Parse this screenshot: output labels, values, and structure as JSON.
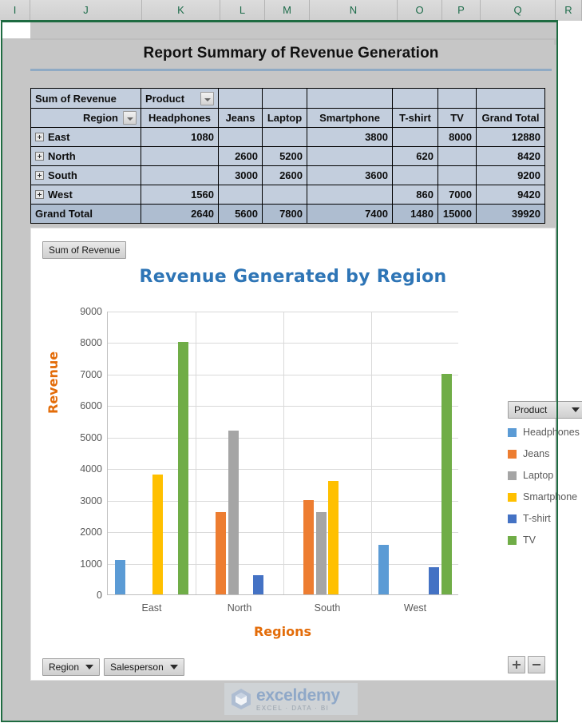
{
  "spreadsheet": {
    "column_headers": [
      "I",
      "J",
      "K",
      "L",
      "M",
      "N",
      "O",
      "P",
      "Q",
      "R"
    ]
  },
  "report": {
    "title": "Report Summary of Revenue Generation"
  },
  "pivot_table": {
    "value_field_label": "Sum of Revenue",
    "column_field_label": "Product",
    "row_field_label": "Region",
    "column_headers": [
      "Headphones",
      "Jeans",
      "Laptop",
      "Smartphone",
      "T-shirt",
      "TV",
      "Grand Total"
    ],
    "rows": [
      {
        "region": "East",
        "Headphones": "1080",
        "Jeans": "",
        "Laptop": "",
        "Smartphone": "3800",
        "T-shirt": "",
        "TV": "8000",
        "Grand Total": "12880"
      },
      {
        "region": "North",
        "Headphones": "",
        "Jeans": "2600",
        "Laptop": "5200",
        "Smartphone": "",
        "T-shirt": "620",
        "TV": "",
        "Grand Total": "8420"
      },
      {
        "region": "South",
        "Headphones": "",
        "Jeans": "3000",
        "Laptop": "2600",
        "Smartphone": "3600",
        "T-shirt": "",
        "TV": "",
        "Grand Total": "9200"
      },
      {
        "region": "West",
        "Headphones": "1560",
        "Jeans": "",
        "Laptop": "",
        "Smartphone": "",
        "T-shirt": "860",
        "TV": "7000",
        "Grand Total": "9420"
      }
    ],
    "grand_total_row": {
      "label": "Grand Total",
      "Headphones": "2640",
      "Jeans": "5600",
      "Laptop": "7800",
      "Smartphone": "7400",
      "T-shirt": "1480",
      "TV": "15000",
      "Grand Total": "39920"
    }
  },
  "chart_panel": {
    "value_field_button": "Sum of Revenue",
    "legend_field_button": "Product",
    "axis_field_buttons": [
      "Region",
      "Salesperson"
    ],
    "expand_button": "+",
    "collapse_button": "-"
  },
  "chart_data": {
    "type": "bar",
    "title": "Revenue Generated by Region",
    "xlabel": "Regions",
    "ylabel": "Revenue",
    "categories": [
      "East",
      "North",
      "South",
      "West"
    ],
    "ylim": [
      0,
      9000
    ],
    "yticks": [
      "0",
      "1000",
      "2000",
      "3000",
      "4000",
      "5000",
      "6000",
      "7000",
      "8000",
      "9000"
    ],
    "grid": true,
    "legend_position": "right",
    "series": [
      {
        "name": "Headphones",
        "color": "#5B9BD5",
        "values": [
          1080,
          null,
          null,
          1560
        ]
      },
      {
        "name": "Jeans",
        "color": "#ED7D31",
        "values": [
          null,
          2600,
          3000,
          null
        ]
      },
      {
        "name": "Laptop",
        "color": "#A5A5A5",
        "values": [
          null,
          5200,
          2600,
          null
        ]
      },
      {
        "name": "Smartphone",
        "color": "#FFC000",
        "values": [
          3800,
          null,
          3600,
          null
        ]
      },
      {
        "name": "T-shirt",
        "color": "#4472C4",
        "values": [
          null,
          620,
          null,
          860
        ]
      },
      {
        "name": "TV",
        "color": "#70AD47",
        "values": [
          8000,
          null,
          null,
          7000
        ]
      }
    ]
  },
  "watermark": {
    "name": "exceldemy",
    "tagline": "EXCEL · DATA · BI"
  }
}
